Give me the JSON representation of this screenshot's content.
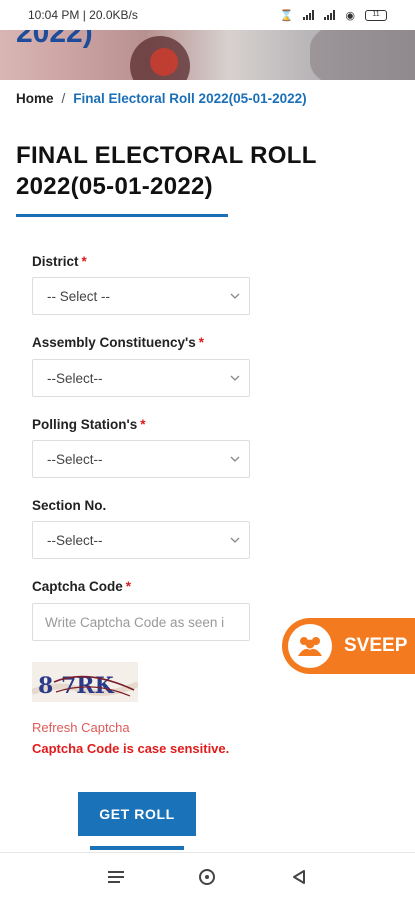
{
  "status_bar": {
    "time_speed": "10:04 PM | 20.0KB/s",
    "battery": "11"
  },
  "hero": {
    "title_fragment": "2022)"
  },
  "breadcrumb": {
    "home": "Home",
    "separator": "/",
    "current": "Final Electoral Roll 2022(05-01-2022)"
  },
  "page": {
    "title": "FINAL ELECTORAL ROLL 2022(05-01-2022)"
  },
  "form": {
    "district": {
      "label": "District",
      "required": "*",
      "value": "-- Select --"
    },
    "assembly": {
      "label": "Assembly Constituency's",
      "required": "*",
      "value": "--Select--"
    },
    "polling": {
      "label": "Polling Station's",
      "required": "*",
      "value": "--Select--"
    },
    "section": {
      "label": "Section No.",
      "value": "--Select--"
    },
    "captcha": {
      "label": "Captcha Code",
      "required": "*",
      "placeholder": "Write Captcha Code as seen i",
      "image_text": "8 7RK"
    },
    "refresh_label": "Refresh Captcha",
    "case_note": "Captcha Code is case sensitive.",
    "submit_label": "GET ROLL"
  },
  "floating": {
    "sveep_label": "SVEEP"
  },
  "icons": {
    "chevron": "chevron-down-icon",
    "sveep": "people-group-icon",
    "nav": [
      "menu-icon",
      "home-circle-icon",
      "back-triangle-icon"
    ]
  },
  "colors": {
    "accent_blue": "#1a73b8",
    "link_blue": "#1a6fb6",
    "required_red": "#d81b1b",
    "sveep_orange": "#f47a1f"
  }
}
